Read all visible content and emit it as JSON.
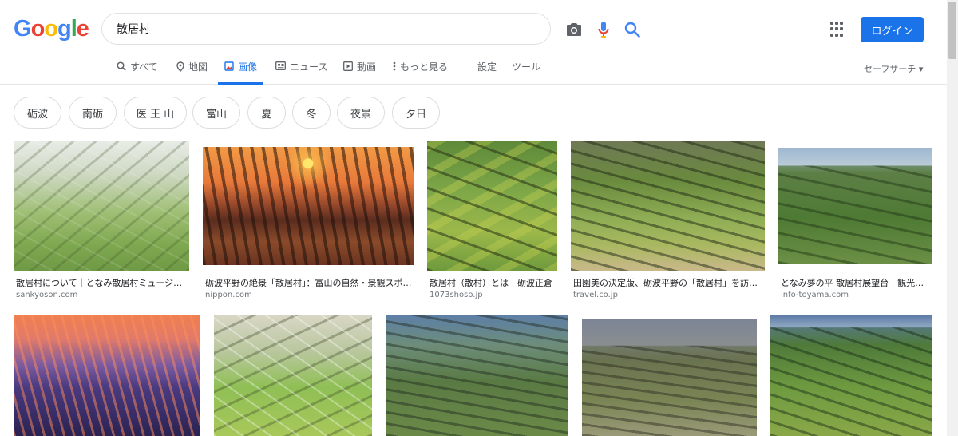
{
  "search": {
    "query": "散居村"
  },
  "logo": {
    "letters": [
      "G",
      "o",
      "o",
      "g",
      "l",
      "e"
    ],
    "colors": [
      "#4285f4",
      "#ea4335",
      "#fbbc05",
      "#4285f4",
      "#34a853",
      "#ea4335"
    ]
  },
  "header": {
    "login_label": "ログイン"
  },
  "tabs": {
    "all": "すべて",
    "maps": "地図",
    "images": "画像",
    "news": "ニュース",
    "videos": "動画",
    "more": "もっと見る",
    "settings": "設定",
    "tools": "ツール"
  },
  "safesearch": "セーフサーチ ▾",
  "chips": [
    "砺波",
    "南砺",
    "医 王 山",
    "富山",
    "夏",
    "冬",
    "夜景",
    "夕日"
  ],
  "results_row1": [
    {
      "caption": "散居村について｜となみ散居村ミュージアム…",
      "domain": "sankyoson.com"
    },
    {
      "caption": "砺波平野の絶景「散居村」：富山の自然・景観スポ…",
      "domain": "nippon.com"
    },
    {
      "caption": "散居村（散村）とは｜砺波正倉",
      "domain": "1073shoso.jp"
    },
    {
      "caption": "田園美の決定版、砺波平野の「散居村」を訪ね…",
      "domain": "travel.co.jp"
    },
    {
      "caption": "となみ夢の平 散居村展望台｜観光ス…",
      "domain": "info-toyama.com"
    }
  ],
  "colors": {
    "accent": "#1a73e8",
    "muted": "#5f6368"
  }
}
